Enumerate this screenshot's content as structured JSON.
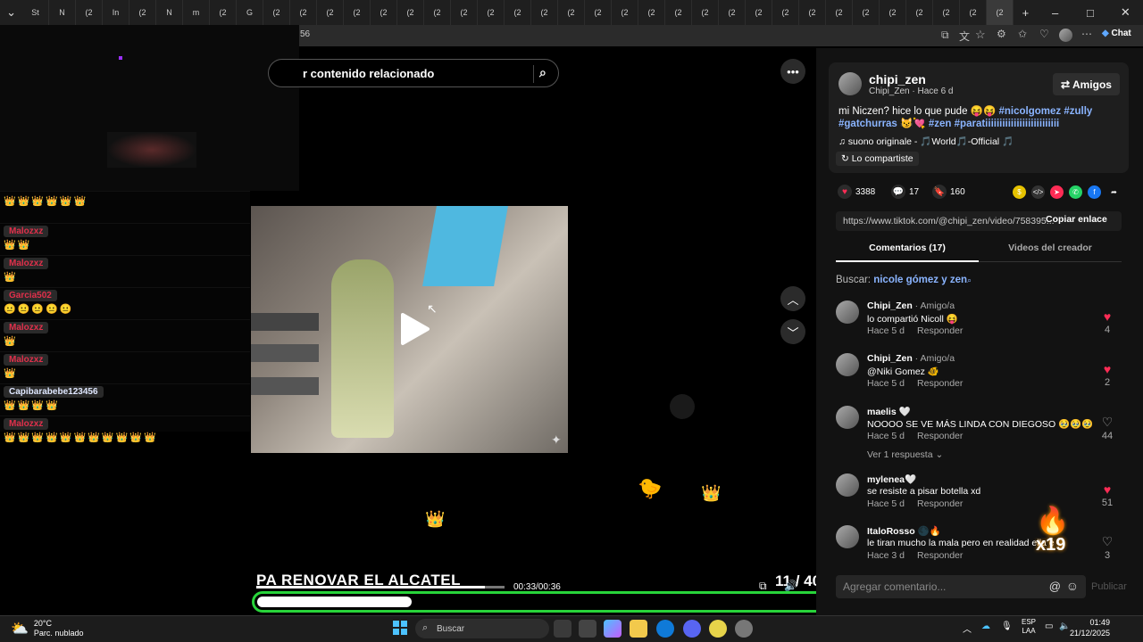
{
  "browser": {
    "tabs": [
      "St",
      "N",
      "(2",
      "In",
      "(2",
      "N",
      "m",
      "(2",
      "G",
      "(2",
      "(2",
      "(2",
      "(2",
      "(2",
      "(2",
      "(2",
      "(2",
      "(2",
      "(2",
      "(2",
      "(2",
      "(2",
      "(2",
      "(2",
      "(2",
      "(2",
      "(2",
      "(2",
      "(2",
      "(2",
      "(2",
      "(2",
      "(2",
      "(2",
      "(2",
      "(2",
      "(2"
    ],
    "new_tab": "+",
    "minimize": "–",
    "maximize": "□",
    "close": "✕",
    "url_fragment": "56",
    "chat_label": "Chat"
  },
  "chat": {
    "rows": [
      {
        "user": "",
        "emotes": "👑👑👑👑👑👑"
      },
      {
        "user": "Malozxz",
        "emotes": "👑👑"
      },
      {
        "user": "Malozxz",
        "emotes": "👑"
      },
      {
        "user": "Garcia502",
        "emotes": "😐😐😐😐😐"
      },
      {
        "user": "Malozxz",
        "emotes": "👑"
      },
      {
        "user": "Malozxz",
        "emotes": "👑"
      },
      {
        "user": "Capibarabebe123456",
        "emotes": "👑👑👑👑"
      },
      {
        "user": "Malozxz",
        "emotes": "👑👑👑👑👑👑👑👑👑👑👑"
      }
    ]
  },
  "search": {
    "placeholder": "r contenido relacionado"
  },
  "video": {
    "caption": "PA RENOVAR EL ALCATEL",
    "progress": 0.92,
    "time": "00:33/00:36",
    "counter": "11 / 40",
    "overlay_progress": 0.27
  },
  "post": {
    "author": "chipi_zen",
    "author_sub": "Chipi_Zen · Hace 6 d",
    "follow_label": "⇄ Amigos",
    "desc_text": "mi Niczen? hice lo que pude 😝😝",
    "tags": [
      "#nicolgomez",
      "#zully",
      "#gatchurras",
      "#zen",
      "#paratiiiiiiiiiiiiiiiiiiiiiiiiii"
    ],
    "music": "♫  suono originale - 🎵World🎵-Official 🎵",
    "shared": "Lo compartiste",
    "likes": "3388",
    "comments_count": "17",
    "saves": "160",
    "link": "https://www.tiktok.com/@chipi_zen/video/758395...",
    "copy_label": "Copiar enlace"
  },
  "panel_tabs": {
    "comments": "Comentarios (17)",
    "videos": "Videos del creador"
  },
  "comment_search": {
    "prefix": "Buscar:",
    "query": "nicole gómez y zen"
  },
  "comments": [
    {
      "user": "Chipi_Zen",
      "sub": " · Amigo/a",
      "text": "lo compartió Nicoll 😝",
      "time": "Hace 5 d",
      "reply": "Responder",
      "likes": "4",
      "liked": true
    },
    {
      "user": "Chipi_Zen",
      "sub": " · Amigo/a",
      "text": "@Niki Gomez 🐠",
      "time": "Hace 5 d",
      "reply": "Responder",
      "likes": "2",
      "liked": true
    },
    {
      "user": "maelis 🤍",
      "sub": "",
      "text": "NOOOO SE VE MÁS LINDA CON DIEGOSO 🥹🥹🥹",
      "time": "Hace 5 d",
      "reply": "Responder",
      "likes": "44",
      "liked": false
    },
    {
      "user": "mylenea🤍",
      "sub": "",
      "text": "se resiste a pisar botella xd",
      "time": "Hace 5 d",
      "reply": "Responder",
      "likes": "51",
      "liked": true
    },
    {
      "user": "ItaloRosso 🌑🔥",
      "sub": "",
      "text": "le tiran mucho la mala pero en realidad ella e",
      "time": "Hace 3 d",
      "reply": "Responder",
      "likes": "3",
      "liked": false
    }
  ],
  "replies_label": "Ver 1 respuesta ⌄",
  "comment_input": {
    "placeholder": "Agregar comentario...",
    "post_label": "Publicar"
  },
  "overlay_badge": "x19",
  "taskbar": {
    "temp": "20°C",
    "weather": "Parc. nublado",
    "search": "Buscar",
    "lang_top": "ESP",
    "lang_bottom": "LAA",
    "time": "01:49",
    "date": "21/12/2025"
  }
}
